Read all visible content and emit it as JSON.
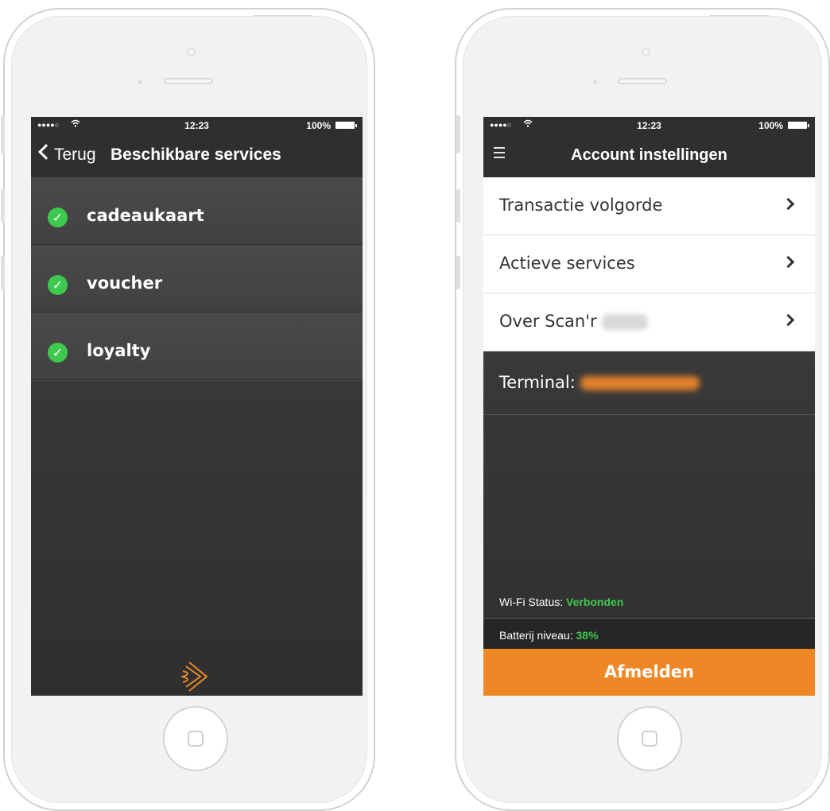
{
  "left_screen": {
    "status_bar": {
      "signal": "●●●●○",
      "time": "12:23",
      "battery": "100%"
    },
    "nav": {
      "back_label": "Terug",
      "title": "Beschikbare services"
    },
    "services": [
      {
        "label": "cadeaukaart"
      },
      {
        "label": "voucher"
      },
      {
        "label": "loyalty"
      }
    ]
  },
  "right_screen": {
    "status_bar": {
      "signal": "●●●●○",
      "time": "12:23",
      "battery": "100%"
    },
    "nav": {
      "title": "Account instellingen"
    },
    "menu": [
      {
        "label": "Transactie volgorde"
      },
      {
        "label": "Actieve services"
      },
      {
        "label": "Over Scan'r"
      }
    ],
    "terminal_label": "Terminal:",
    "wifi_label": "Wi-Fi Status:",
    "wifi_value": "Verbonden",
    "battery_label": "Batterij niveau:",
    "battery_value": "38%",
    "logout_label": "Afmelden"
  },
  "colors": {
    "accent": "#ee8726",
    "status_green": "#3ec84e",
    "bar": "#2f2f2f"
  }
}
